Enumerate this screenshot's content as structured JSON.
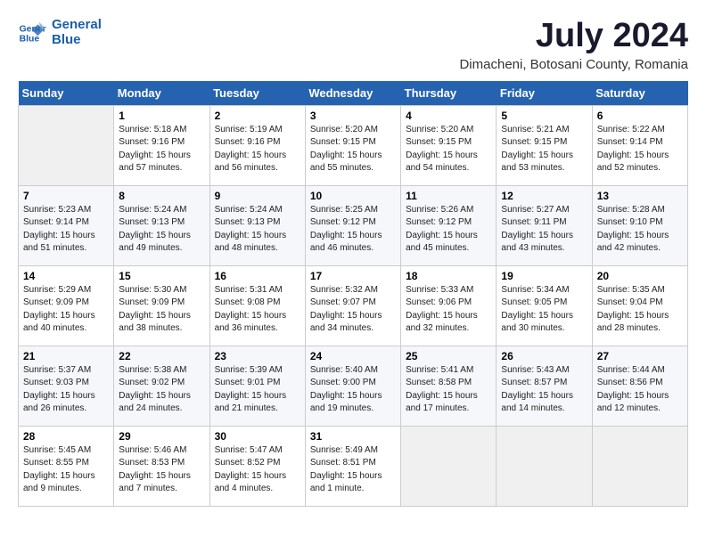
{
  "logo": {
    "name_line1": "General",
    "name_line2": "Blue"
  },
  "title": "July 2024",
  "subtitle": "Dimacheni, Botosani County, Romania",
  "weekdays": [
    "Sunday",
    "Monday",
    "Tuesday",
    "Wednesday",
    "Thursday",
    "Friday",
    "Saturday"
  ],
  "weeks": [
    [
      {
        "day": "",
        "info": ""
      },
      {
        "day": "1",
        "info": "Sunrise: 5:18 AM\nSunset: 9:16 PM\nDaylight: 15 hours\nand 57 minutes."
      },
      {
        "day": "2",
        "info": "Sunrise: 5:19 AM\nSunset: 9:16 PM\nDaylight: 15 hours\nand 56 minutes."
      },
      {
        "day": "3",
        "info": "Sunrise: 5:20 AM\nSunset: 9:15 PM\nDaylight: 15 hours\nand 55 minutes."
      },
      {
        "day": "4",
        "info": "Sunrise: 5:20 AM\nSunset: 9:15 PM\nDaylight: 15 hours\nand 54 minutes."
      },
      {
        "day": "5",
        "info": "Sunrise: 5:21 AM\nSunset: 9:15 PM\nDaylight: 15 hours\nand 53 minutes."
      },
      {
        "day": "6",
        "info": "Sunrise: 5:22 AM\nSunset: 9:14 PM\nDaylight: 15 hours\nand 52 minutes."
      }
    ],
    [
      {
        "day": "7",
        "info": "Sunrise: 5:23 AM\nSunset: 9:14 PM\nDaylight: 15 hours\nand 51 minutes."
      },
      {
        "day": "8",
        "info": "Sunrise: 5:24 AM\nSunset: 9:13 PM\nDaylight: 15 hours\nand 49 minutes."
      },
      {
        "day": "9",
        "info": "Sunrise: 5:24 AM\nSunset: 9:13 PM\nDaylight: 15 hours\nand 48 minutes."
      },
      {
        "day": "10",
        "info": "Sunrise: 5:25 AM\nSunset: 9:12 PM\nDaylight: 15 hours\nand 46 minutes."
      },
      {
        "day": "11",
        "info": "Sunrise: 5:26 AM\nSunset: 9:12 PM\nDaylight: 15 hours\nand 45 minutes."
      },
      {
        "day": "12",
        "info": "Sunrise: 5:27 AM\nSunset: 9:11 PM\nDaylight: 15 hours\nand 43 minutes."
      },
      {
        "day": "13",
        "info": "Sunrise: 5:28 AM\nSunset: 9:10 PM\nDaylight: 15 hours\nand 42 minutes."
      }
    ],
    [
      {
        "day": "14",
        "info": "Sunrise: 5:29 AM\nSunset: 9:09 PM\nDaylight: 15 hours\nand 40 minutes."
      },
      {
        "day": "15",
        "info": "Sunrise: 5:30 AM\nSunset: 9:09 PM\nDaylight: 15 hours\nand 38 minutes."
      },
      {
        "day": "16",
        "info": "Sunrise: 5:31 AM\nSunset: 9:08 PM\nDaylight: 15 hours\nand 36 minutes."
      },
      {
        "day": "17",
        "info": "Sunrise: 5:32 AM\nSunset: 9:07 PM\nDaylight: 15 hours\nand 34 minutes."
      },
      {
        "day": "18",
        "info": "Sunrise: 5:33 AM\nSunset: 9:06 PM\nDaylight: 15 hours\nand 32 minutes."
      },
      {
        "day": "19",
        "info": "Sunrise: 5:34 AM\nSunset: 9:05 PM\nDaylight: 15 hours\nand 30 minutes."
      },
      {
        "day": "20",
        "info": "Sunrise: 5:35 AM\nSunset: 9:04 PM\nDaylight: 15 hours\nand 28 minutes."
      }
    ],
    [
      {
        "day": "21",
        "info": "Sunrise: 5:37 AM\nSunset: 9:03 PM\nDaylight: 15 hours\nand 26 minutes."
      },
      {
        "day": "22",
        "info": "Sunrise: 5:38 AM\nSunset: 9:02 PM\nDaylight: 15 hours\nand 24 minutes."
      },
      {
        "day": "23",
        "info": "Sunrise: 5:39 AM\nSunset: 9:01 PM\nDaylight: 15 hours\nand 21 minutes."
      },
      {
        "day": "24",
        "info": "Sunrise: 5:40 AM\nSunset: 9:00 PM\nDaylight: 15 hours\nand 19 minutes."
      },
      {
        "day": "25",
        "info": "Sunrise: 5:41 AM\nSunset: 8:58 PM\nDaylight: 15 hours\nand 17 minutes."
      },
      {
        "day": "26",
        "info": "Sunrise: 5:43 AM\nSunset: 8:57 PM\nDaylight: 15 hours\nand 14 minutes."
      },
      {
        "day": "27",
        "info": "Sunrise: 5:44 AM\nSunset: 8:56 PM\nDaylight: 15 hours\nand 12 minutes."
      }
    ],
    [
      {
        "day": "28",
        "info": "Sunrise: 5:45 AM\nSunset: 8:55 PM\nDaylight: 15 hours\nand 9 minutes."
      },
      {
        "day": "29",
        "info": "Sunrise: 5:46 AM\nSunset: 8:53 PM\nDaylight: 15 hours\nand 7 minutes."
      },
      {
        "day": "30",
        "info": "Sunrise: 5:47 AM\nSunset: 8:52 PM\nDaylight: 15 hours\nand 4 minutes."
      },
      {
        "day": "31",
        "info": "Sunrise: 5:49 AM\nSunset: 8:51 PM\nDaylight: 15 hours\nand 1 minute."
      },
      {
        "day": "",
        "info": ""
      },
      {
        "day": "",
        "info": ""
      },
      {
        "day": "",
        "info": ""
      }
    ]
  ]
}
